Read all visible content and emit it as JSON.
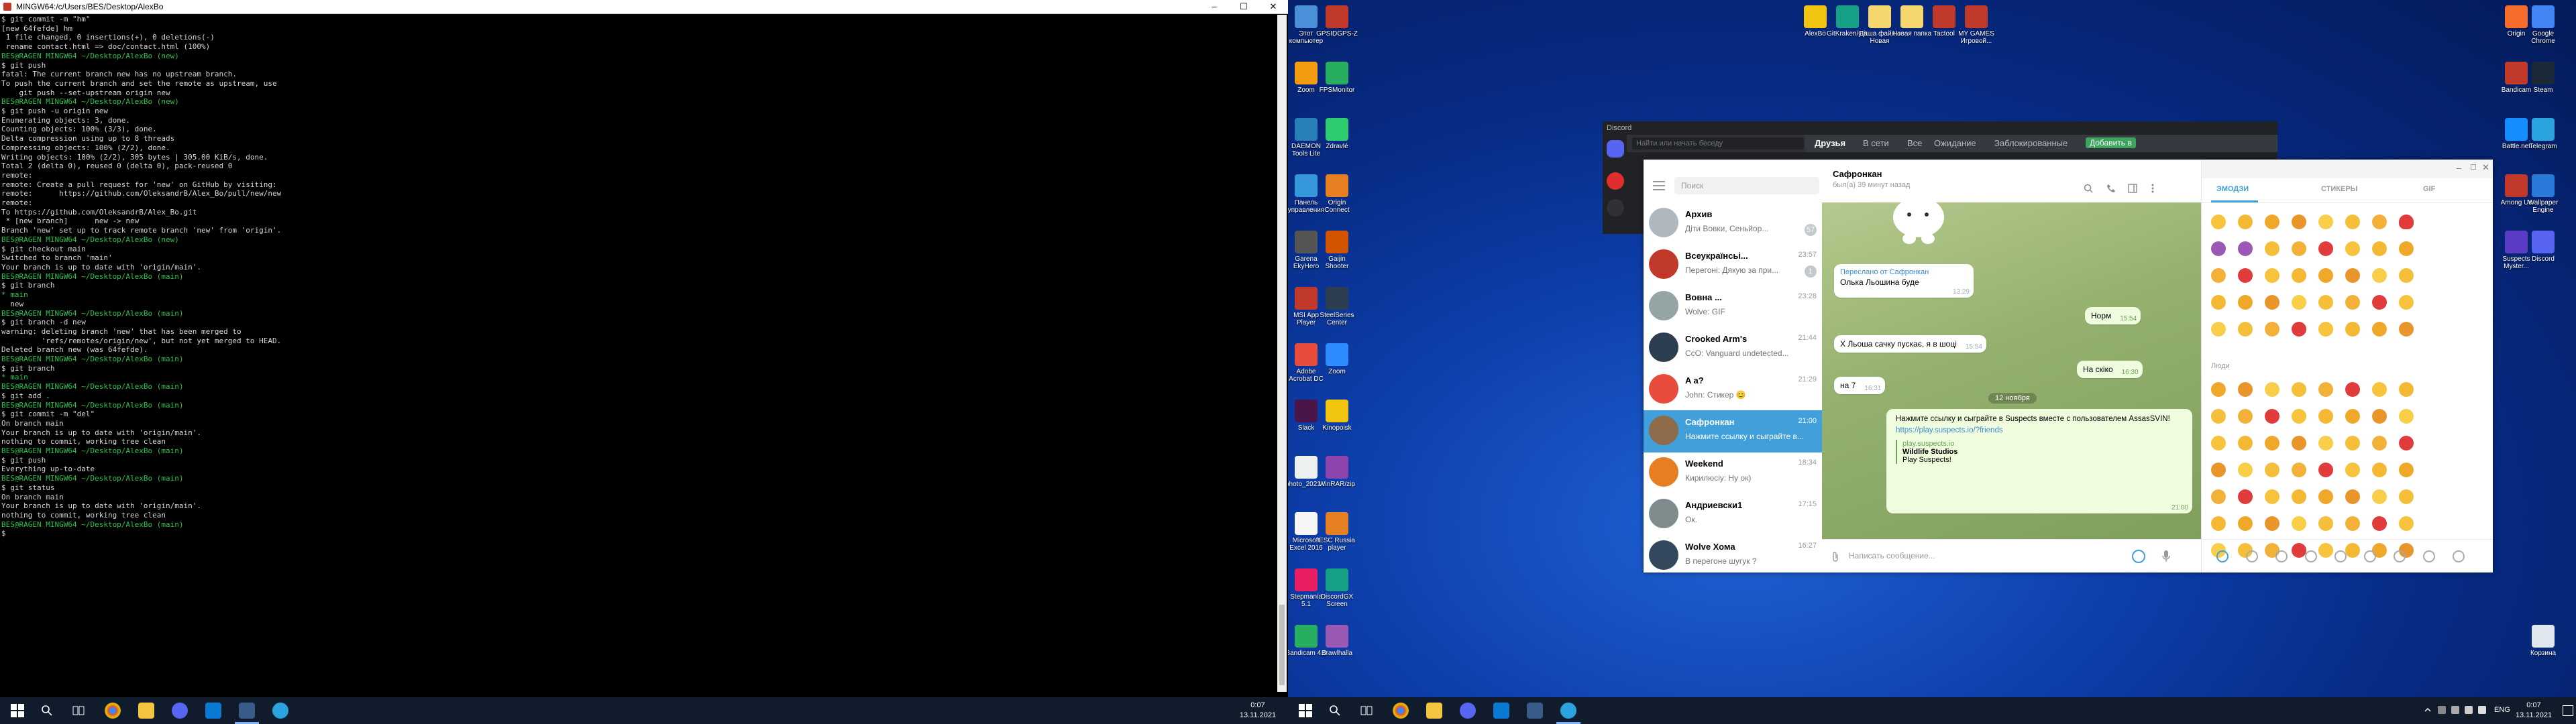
{
  "terminal": {
    "title": "MINGW64:/c/Users/BES/Desktop/AlexBo",
    "window_buttons": [
      "–",
      "☐",
      "✕"
    ],
    "lines": [
      {
        "t": "$ git commit -m \"hm\"",
        "c": ""
      },
      {
        "t": "[new 64fefde] hm",
        "c": ""
      },
      {
        "t": " 1 file changed, 0 insertions(+), 0 deletions(-)",
        "c": ""
      },
      {
        "t": " rename contact.html => doc/contact.html (100%)",
        "c": ""
      },
      {
        "t": "",
        "c": ""
      },
      {
        "t": "BES@RAGEN MINGW64 ~/Desktop/AlexBo (new)",
        "c": "prompt"
      },
      {
        "t": "$ git push",
        "c": ""
      },
      {
        "t": "fatal: The current branch new has no upstream branch.",
        "c": ""
      },
      {
        "t": "To push the current branch and set the remote as upstream, use",
        "c": ""
      },
      {
        "t": "",
        "c": ""
      },
      {
        "t": "    git push --set-upstream origin new",
        "c": ""
      },
      {
        "t": "",
        "c": ""
      },
      {
        "t": "",
        "c": ""
      },
      {
        "t": "BES@RAGEN MINGW64 ~/Desktop/AlexBo (new)",
        "c": "prompt"
      },
      {
        "t": "$ git push -u origin new",
        "c": ""
      },
      {
        "t": "Enumerating objects: 3, done.",
        "c": ""
      },
      {
        "t": "Counting objects: 100% (3/3), done.",
        "c": ""
      },
      {
        "t": "Delta compression using up to 8 threads",
        "c": ""
      },
      {
        "t": "Compressing objects: 100% (2/2), done.",
        "c": ""
      },
      {
        "t": "Writing objects: 100% (2/2), 305 bytes | 305.00 KiB/s, done.",
        "c": ""
      },
      {
        "t": "Total 2 (delta 0), reused 0 (delta 0), pack-reused 0",
        "c": ""
      },
      {
        "t": "remote:",
        "c": ""
      },
      {
        "t": "remote: Create a pull request for 'new' on GitHub by visiting:",
        "c": ""
      },
      {
        "t": "remote:      https://github.com/OleksandrB/Alex_Bo/pull/new/new",
        "c": ""
      },
      {
        "t": "remote:",
        "c": ""
      },
      {
        "t": "To https://github.com/OleksandrB/Alex_Bo.git",
        "c": ""
      },
      {
        "t": " * [new branch]      new -> new",
        "c": ""
      },
      {
        "t": "Branch 'new' set up to track remote branch 'new' from 'origin'.",
        "c": ""
      },
      {
        "t": "",
        "c": ""
      },
      {
        "t": "BES@RAGEN MINGW64 ~/Desktop/AlexBo (new)",
        "c": "prompt"
      },
      {
        "t": "$ git checkout main",
        "c": ""
      },
      {
        "t": "Switched to branch 'main'",
        "c": ""
      },
      {
        "t": "Your branch is up to date with 'origin/main'.",
        "c": ""
      },
      {
        "t": "",
        "c": ""
      },
      {
        "t": "BES@RAGEN MINGW64 ~/Desktop/AlexBo (main)",
        "c": "prompt"
      },
      {
        "t": "$ git branch",
        "c": ""
      },
      {
        "t": "* main",
        "c": "green"
      },
      {
        "t": "  new",
        "c": ""
      },
      {
        "t": "",
        "c": ""
      },
      {
        "t": "BES@RAGEN MINGW64 ~/Desktop/AlexBo (main)",
        "c": "prompt"
      },
      {
        "t": "$ git branch -d new",
        "c": ""
      },
      {
        "t": "warning: deleting branch 'new' that has been merged to",
        "c": ""
      },
      {
        "t": "         'refs/remotes/origin/new', but not yet merged to HEAD.",
        "c": ""
      },
      {
        "t": "Deleted branch new (was 64fefde).",
        "c": ""
      },
      {
        "t": "",
        "c": ""
      },
      {
        "t": "BES@RAGEN MINGW64 ~/Desktop/AlexBo (main)",
        "c": "prompt"
      },
      {
        "t": "$ git branch",
        "c": ""
      },
      {
        "t": "* main",
        "c": "green"
      },
      {
        "t": "",
        "c": ""
      },
      {
        "t": "BES@RAGEN MINGW64 ~/Desktop/AlexBo (main)",
        "c": "prompt"
      },
      {
        "t": "$ git add .",
        "c": ""
      },
      {
        "t": "",
        "c": ""
      },
      {
        "t": "BES@RAGEN MINGW64 ~/Desktop/AlexBo (main)",
        "c": "prompt"
      },
      {
        "t": "$ git commit -m \"del\"",
        "c": ""
      },
      {
        "t": "On branch main",
        "c": ""
      },
      {
        "t": "Your branch is up to date with 'origin/main'.",
        "c": ""
      },
      {
        "t": "",
        "c": ""
      },
      {
        "t": "nothing to commit, working tree clean",
        "c": ""
      },
      {
        "t": "",
        "c": ""
      },
      {
        "t": "BES@RAGEN MINGW64 ~/Desktop/AlexBo (main)",
        "c": "prompt"
      },
      {
        "t": "$ git push",
        "c": ""
      },
      {
        "t": "Everything up-to-date",
        "c": ""
      },
      {
        "t": "",
        "c": ""
      },
      {
        "t": "BES@RAGEN MINGW64 ~/Desktop/AlexBo (main)",
        "c": "prompt"
      },
      {
        "t": "$ git status",
        "c": ""
      },
      {
        "t": "On branch main",
        "c": ""
      },
      {
        "t": "Your branch is up to date with 'origin/main'.",
        "c": ""
      },
      {
        "t": "",
        "c": ""
      },
      {
        "t": "nothing to commit, working tree clean",
        "c": ""
      },
      {
        "t": "",
        "c": ""
      },
      {
        "t": "BES@RAGEN MINGW64 ~/Desktop/AlexBo (main)",
        "c": "prompt"
      },
      {
        "t": "$",
        "c": ""
      }
    ]
  },
  "taskbar_left": {
    "time": "0:07",
    "date": "13.11.2021"
  },
  "taskbar_right": {
    "lang": "ENG",
    "time": "0:07",
    "date": "13.11.2021"
  },
  "desktop_icons": [
    {
      "label": "Этот компьютер",
      "color": "#4a90d9"
    },
    {
      "label": "GPSIDGPS-Z",
      "color": "#c0392b"
    },
    {
      "label": "Zoom",
      "color": "#f39c12"
    },
    {
      "label": "FPSMonitor",
      "color": "#27ae60"
    },
    {
      "label": "DAEMON Tools Lite",
      "color": "#2980b9"
    },
    {
      "label": "Zdravlé",
      "color": "#2ecc71"
    },
    {
      "label": "Панель управления",
      "color": "#3498db"
    },
    {
      "label": "Origin Connect",
      "color": "#e67e22"
    },
    {
      "label": "Garena EkyHero",
      "color": "#555555"
    },
    {
      "label": "Gaijin Shooter",
      "color": "#d35400"
    },
    {
      "label": "MSI App Player",
      "color": "#c0392b"
    },
    {
      "label": "SteelSeries Center",
      "color": "#2c3e50"
    },
    {
      "label": "Adobe Acrobat DC",
      "color": "#e74c3c"
    },
    {
      "label": "Zoom",
      "color": "#2d8cff"
    },
    {
      "label": "Slack",
      "color": "#4a154b"
    },
    {
      "label": "Kinopoisk",
      "color": "#f1c40f"
    },
    {
      "label": "photo_2021-...",
      "color": "#ecf0f1"
    },
    {
      "label": "WinRAR/zip",
      "color": "#8e44ad"
    },
    {
      "label": "Microsoft Excel 2016",
      "color": "#f5f5f5"
    },
    {
      "label": "ESC Russia player",
      "color": "#e67e22"
    },
    {
      "label": "Stepmania 5.1",
      "color": "#e91e63"
    },
    {
      "label": "DiscordGX Screen",
      "color": "#16a085"
    },
    {
      "label": "Bandicam 4.0",
      "color": "#27ae60"
    },
    {
      "label": "Brawlhalla",
      "color": "#9b59b6"
    }
  ],
  "desktop_top_icons": [
    {
      "label": "AlexBo",
      "color": "#f1c40f"
    },
    {
      "label": "GitKraken/Git...",
      "color": "#16a085"
    },
    {
      "label": "Даша файлы Новая пакета колепной",
      "color": "#f5d76e"
    },
    {
      "label": "Новая папка",
      "color": "#f5d76e"
    },
    {
      "label": "Tactool",
      "color": "#c0392b"
    },
    {
      "label": "MY GAMES Игровой...",
      "color": "#c0392b"
    }
  ],
  "desktop_right_icons": [
    {
      "label": "Origin",
      "color": "#f56c2d"
    },
    {
      "label": "Google Chrome",
      "color": "#4285f4"
    },
    {
      "label": "Bandicam",
      "color": "#c0392b"
    },
    {
      "label": "Steam",
      "color": "#1b2838"
    },
    {
      "label": "Battle.net",
      "color": "#148eff"
    },
    {
      "label": "Telegram",
      "color": "#2aa3df"
    },
    {
      "label": "Among Us",
      "color": "#c0392b"
    },
    {
      "label": "Wallpaper Engine",
      "color": "#2b79d8"
    },
    {
      "label": "Suspects Myster...",
      "color": "#5b3cc4"
    },
    {
      "label": "Discord",
      "color": "#5865f2"
    },
    {
      "label": "Корзина",
      "color": "#dfe6ee"
    }
  ],
  "discord": {
    "title": "Discord",
    "search_placeholder": "Найти или начать беседу",
    "tabs": [
      "Друзья",
      "В сети",
      "Все",
      "Ожидание",
      "Заблокированные"
    ],
    "add_friend": "Добавить в"
  },
  "telegram": {
    "search_placeholder": "Поиск",
    "chats": [
      {
        "name": "Архив",
        "preview": "Діти Вовки, Сеньйор...",
        "time": "",
        "badge": "57",
        "color": "#b0b8bf"
      },
      {
        "name": "Всеукраїнсьі...",
        "preview": "Перегоні: Дякую за при...",
        "time": "23:57",
        "badge": "1",
        "color": "#c0392b"
      },
      {
        "name": "Вовна ...",
        "preview": "Wolve: GIF",
        "time": "23:28",
        "badge": "",
        "color": "#95a5a6"
      },
      {
        "name": "Crooked Arm's",
        "preview": "CcO: Vanguard undetected...",
        "time": "21:44",
        "badge": "",
        "color": "#2c3e50"
      },
      {
        "name": "A a?",
        "preview": "John: Стикер 😊",
        "time": "21:29",
        "badge": "",
        "color": "#e74c3c"
      },
      {
        "name": "Сафронкан",
        "preview": "Нажмите ссылку и сыграйте в...",
        "time": "21:00",
        "badge": "",
        "color": "#8e6b4a"
      },
      {
        "name": "Weekend",
        "preview": "Кирилюсіу: Ну ок)",
        "time": "18:34",
        "badge": "",
        "color": "#e67e22"
      },
      {
        "name": "Андриевски1",
        "preview": "Ок.",
        "time": "17:15",
        "badge": "",
        "color": "#7f8c8d"
      },
      {
        "name": "Wolve Хома",
        "preview": "В перегоне шугук ?",
        "time": "16:27",
        "badge": "",
        "color": "#34495e"
      }
    ],
    "chat_header": {
      "name": "Сафронкан",
      "status": "был(а) 39 минут назад"
    },
    "forward": {
      "label": "Переслано от Сафронкан",
      "text": "Олька Льошина буде",
      "time": "13:29"
    },
    "messages": [
      {
        "text": "Норм",
        "time": "15:54",
        "out": true
      },
      {
        "text": "Х Льоша сачку пускає, я в шоці",
        "time": "15:54",
        "out": false
      },
      {
        "text": "На скіко",
        "time": "16:30",
        "out": true
      },
      {
        "text": "на 7",
        "time": "16:31",
        "out": false
      }
    ],
    "date_chip": "12 ноября",
    "link_msg": {
      "text": "Нажмите ссылку и сыграйте в Suspects вместе с пользователем AssasSVIN!",
      "url": "https://play.suspects.io/?friends",
      "site": "play.suspects.io",
      "site_title": "Wildlife Studios",
      "site_desc": "Play Suspects!",
      "time": "21:00"
    },
    "input_placeholder": "Написать сообщение...",
    "emoji_tabs": [
      "ЭМОДЗИ",
      "СТИКЕРЫ",
      "GIF"
    ],
    "emoji_section": "Люди"
  }
}
